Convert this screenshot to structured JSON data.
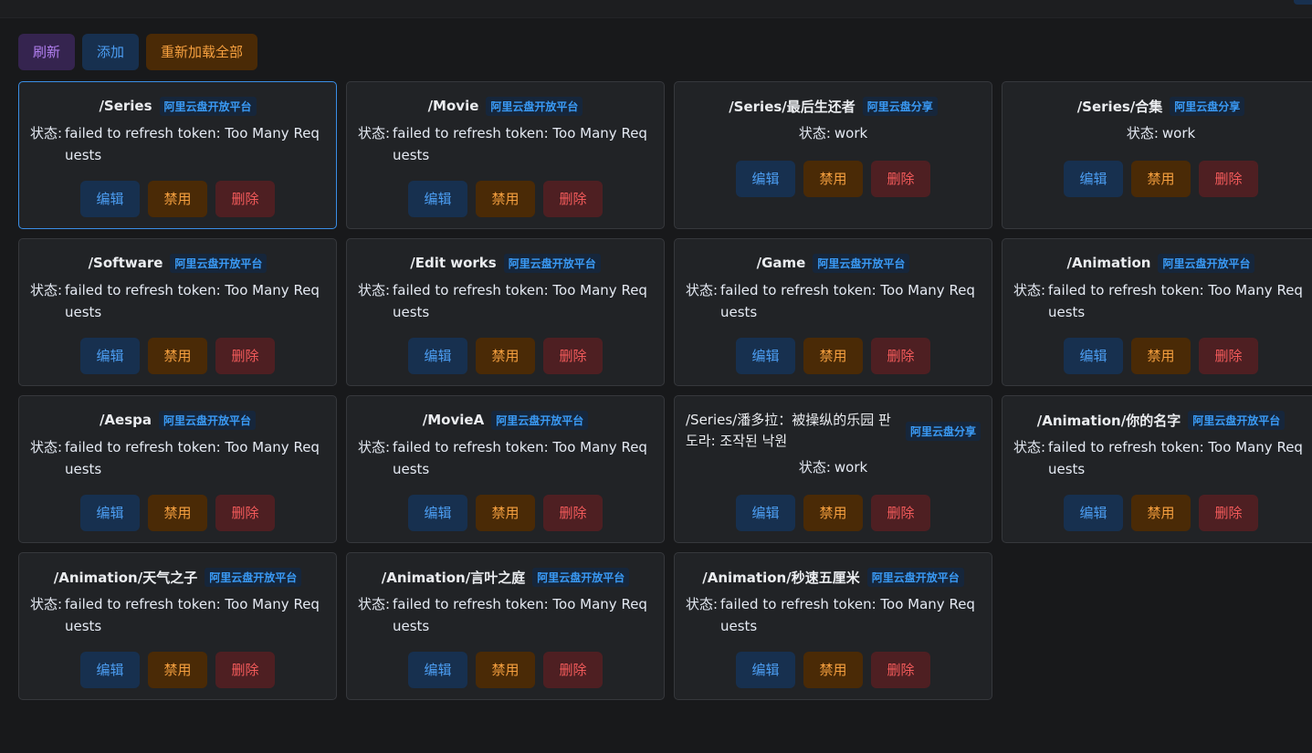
{
  "toolbar": {
    "refresh_label": "刷新",
    "add_label": "添加",
    "reload_all_label": "重新加载全部"
  },
  "card_actions": {
    "edit_label": "编辑",
    "disable_label": "禁用",
    "delete_label": "删除"
  },
  "colors": {
    "background": "#18191b",
    "card_bg": "#212326",
    "accent_blue": "#4c9ef3",
    "accent_orange": "#f6a03f",
    "accent_red": "#f45b5b",
    "accent_purple": "#b27ff0"
  },
  "storages": [
    {
      "path": "/Series",
      "driver": "阿里云盘开放平台",
      "status_label": "状态:",
      "status": "failed to refresh token: Too Many Requests",
      "selected": true
    },
    {
      "path": "/Movie",
      "driver": "阿里云盘开放平台",
      "status_label": "状态:",
      "status": "failed to refresh token: Too Many Requests"
    },
    {
      "path": "/Series/最后生还者",
      "driver": "阿里云盘分享",
      "status_label": "状态:",
      "status": "work"
    },
    {
      "path": "/Series/合集",
      "driver": "阿里云盘分享",
      "status_label": "状态:",
      "status": "work"
    },
    {
      "path": "/Software",
      "driver": "阿里云盘开放平台",
      "status_label": "状态:",
      "status": "failed to refresh token: Too Many Requests"
    },
    {
      "path": "/Edit works",
      "driver": "阿里云盘开放平台",
      "status_label": "状态:",
      "status": "failed to refresh token: Too Many Requests"
    },
    {
      "path": "/Game",
      "driver": "阿里云盘开放平台",
      "status_label": "状态:",
      "status": "failed to refresh token: Too Many Requests"
    },
    {
      "path": "/Animation",
      "driver": "阿里云盘开放平台",
      "status_label": "状态:",
      "status": "failed to refresh token: Too Many Requests"
    },
    {
      "path": "/Aespa",
      "driver": "阿里云盘开放平台",
      "status_label": "状态:",
      "status": "failed to refresh token: Too Many Requests"
    },
    {
      "path": "/MovieA",
      "driver": "阿里云盘开放平台",
      "status_label": "状态:",
      "status": "failed to refresh token: Too Many Requests"
    },
    {
      "path": "/Series/潘多拉：被操纵的乐园 판도라: 조작된 낙원",
      "driver": "阿里云盘分享",
      "status_label": "状态:",
      "status": "work",
      "multiline": true
    },
    {
      "path": "/Animation/你的名字",
      "driver": "阿里云盘开放平台",
      "status_label": "状态:",
      "status": "failed to refresh token: Too Many Requests"
    },
    {
      "path": "/Animation/天气之子",
      "driver": "阿里云盘开放平台",
      "status_label": "状态:",
      "status": "failed to refresh token: Too Many Requests"
    },
    {
      "path": "/Animation/言叶之庭",
      "driver": "阿里云盘开放平台",
      "status_label": "状态:",
      "status": "failed to refresh token: Too Many Requests"
    },
    {
      "path": "/Animation/秒速五厘米",
      "driver": "阿里云盘开放平台",
      "status_label": "状态:",
      "status": "failed to refresh token: Too Many Requests"
    }
  ]
}
